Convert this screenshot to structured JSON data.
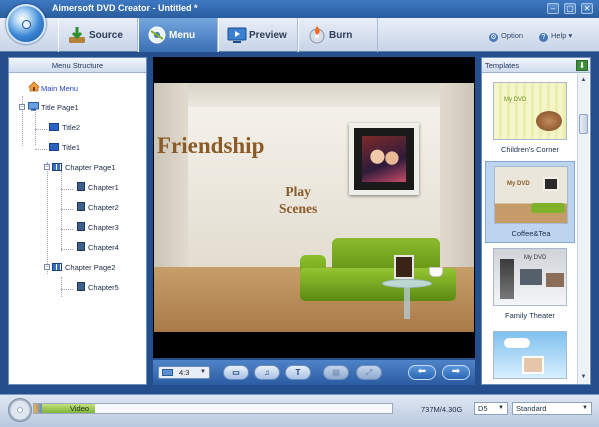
{
  "window": {
    "title": "Aimersoft DVD Creator - Untitled *",
    "minimize": "–",
    "restore": "▢",
    "close": "✕"
  },
  "tabs": [
    {
      "label": "Source",
      "icon": "download-arrow-icon",
      "active": false
    },
    {
      "label": "Menu",
      "icon": "menu-disc-icon",
      "active": true
    },
    {
      "label": "Preview",
      "icon": "monitor-play-icon",
      "active": false
    },
    {
      "label": "Burn",
      "icon": "burn-disc-icon",
      "active": false
    }
  ],
  "top_links": {
    "option": "Option",
    "help": "Help ▾"
  },
  "menu_structure": {
    "header": "Menu Structure",
    "items": [
      "Main Menu",
      "Title Page1",
      "Title2",
      "Title1",
      "Chapter Page1",
      "Chapter1",
      "Chapter2",
      "Chapter3",
      "Chapter4",
      "Chapter Page2",
      "Chapter5"
    ]
  },
  "preview": {
    "menu_title": "Friendship",
    "play_label": "Play",
    "scenes_label": "Scenes",
    "aspect_ratio": "4:3",
    "buttons": {
      "background": "▭",
      "music": "♫",
      "text": "T",
      "thumbnail": "▤",
      "crop": "⤢",
      "prev": "⬅",
      "next": "➡"
    }
  },
  "templates": {
    "header": "Templates",
    "download": "⬇",
    "items": [
      {
        "label": "Children's Corner",
        "selected": false
      },
      {
        "label": "Coffee&Tea",
        "selected": true
      },
      {
        "label": "Family Theater",
        "selected": false
      },
      {
        "label": "",
        "selected": false
      }
    ],
    "thumb_text": [
      "My DVD",
      "My DVD",
      "My DVD"
    ]
  },
  "status": {
    "capacity_label": "Video",
    "capacity_text": "737M/4.30G",
    "capacity_fraction": 0.17,
    "disc_type": "D5",
    "quality": "Standard"
  },
  "colors": {
    "accent": "#3b6fb4",
    "title_text": "#8a5a27",
    "sofa_green": "#7fb22a"
  }
}
